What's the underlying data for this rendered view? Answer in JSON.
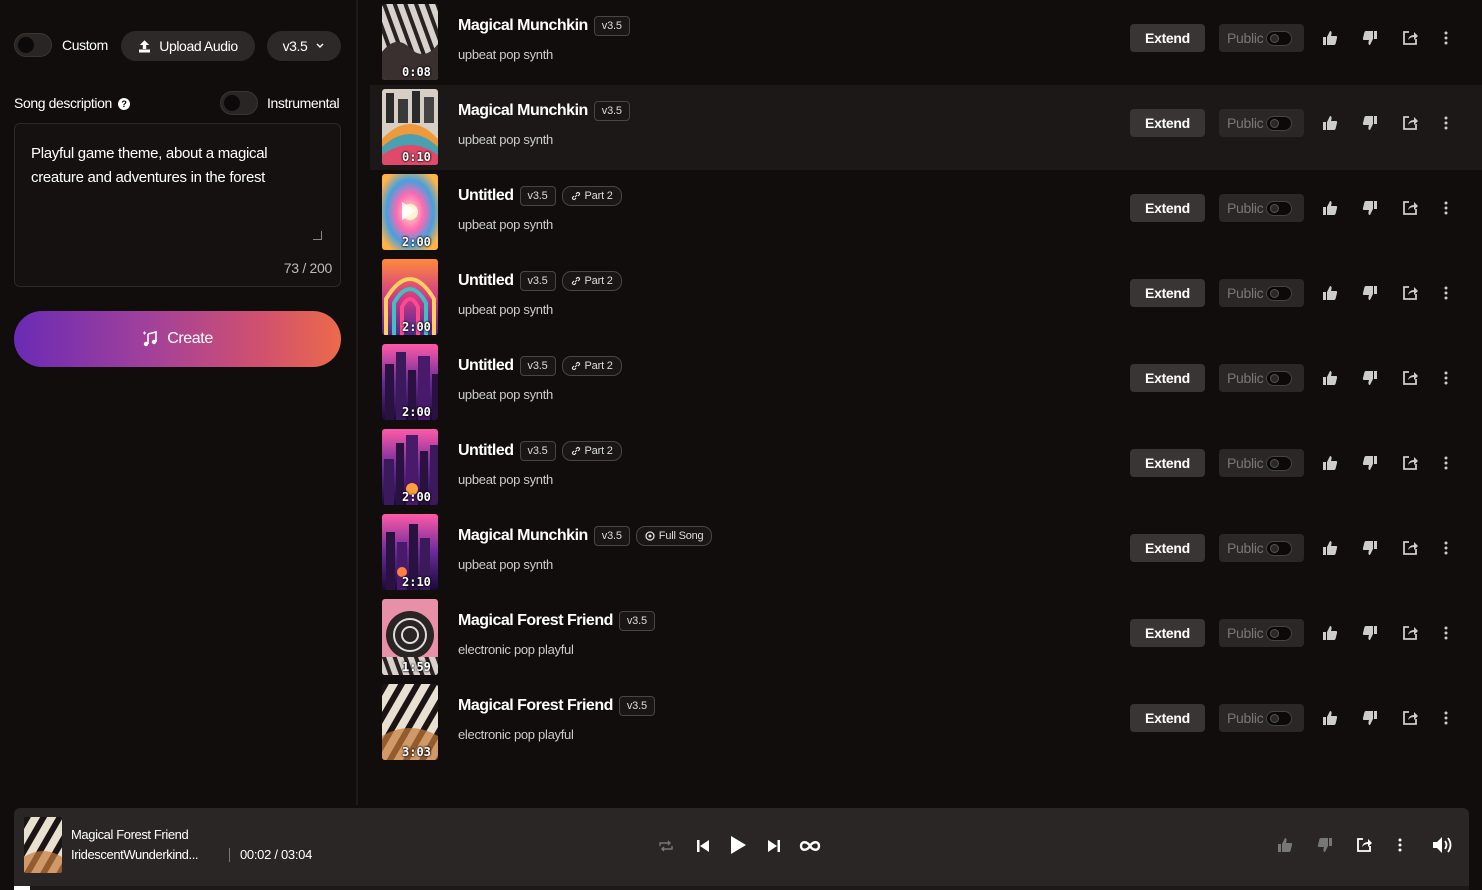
{
  "create_panel": {
    "custom_label": "Custom",
    "upload_label": "Upload Audio",
    "model_version": "v3.5",
    "song_description_label": "Song description",
    "help_icon_glyph": "?",
    "instrumental_label": "Instrumental",
    "description_value": "Playful game theme, about a magical creature and adventures in the forest",
    "char_count": "73 / 200",
    "create_label": "Create"
  },
  "songs": [
    {
      "title": "Magical Munchkin",
      "version": "v3.5",
      "tag": "",
      "style": "upbeat pop synth",
      "duration": "0:08",
      "extend": "Extend",
      "visibility": "Public"
    },
    {
      "title": "Magical Munchkin",
      "version": "v3.5",
      "tag": "",
      "style": "upbeat pop synth",
      "duration": "0:10",
      "extend": "Extend",
      "visibility": "Public"
    },
    {
      "title": "Untitled",
      "version": "v3.5",
      "tag": "Part 2",
      "style": "upbeat pop synth",
      "duration": "2:00",
      "extend": "Extend",
      "visibility": "Public"
    },
    {
      "title": "Untitled",
      "version": "v3.5",
      "tag": "Part 2",
      "style": "upbeat pop synth",
      "duration": "2:00",
      "extend": "Extend",
      "visibility": "Public"
    },
    {
      "title": "Untitled",
      "version": "v3.5",
      "tag": "Part 2",
      "style": "upbeat pop synth",
      "duration": "2:00",
      "extend": "Extend",
      "visibility": "Public"
    },
    {
      "title": "Untitled",
      "version": "v3.5",
      "tag": "Part 2",
      "style": "upbeat pop synth",
      "duration": "2:00",
      "extend": "Extend",
      "visibility": "Public"
    },
    {
      "title": "Magical Munchkin",
      "version": "v3.5",
      "tag": "Full Song",
      "style": "upbeat pop synth",
      "duration": "2:10",
      "extend": "Extend",
      "visibility": "Public"
    },
    {
      "title": "Magical Forest Friend",
      "version": "v3.5",
      "tag": "",
      "style": "electronic pop playful",
      "duration": "1:59",
      "extend": "Extend",
      "visibility": "Public"
    },
    {
      "title": "Magical Forest Friend",
      "version": "v3.5",
      "tag": "",
      "style": "electronic pop playful",
      "duration": "3:03",
      "extend": "Extend",
      "visibility": "Public"
    }
  ],
  "player": {
    "title": "Magical Forest Friend",
    "artist": "IridescentWunderkind...",
    "time": "00:02 / 03:04",
    "progress_fraction": 0.011
  },
  "colors": {
    "background": "#110d0d",
    "highlight_row": "#1c1818",
    "extend_button": "#3a3535",
    "player_bar": "#2b2626",
    "create_gradient_start": "#6a2bb4",
    "create_gradient_end": "#ec6a4a"
  },
  "icons": [
    "upload-icon",
    "chevron-down-icon",
    "music-note-icon",
    "link-icon",
    "record-icon",
    "thumbs-up-icon",
    "thumbs-down-icon",
    "share-icon",
    "more-vertical-icon",
    "repeat-icon",
    "skip-back-icon",
    "play-icon",
    "skip-forward-icon",
    "infinity-icon",
    "volume-icon"
  ]
}
